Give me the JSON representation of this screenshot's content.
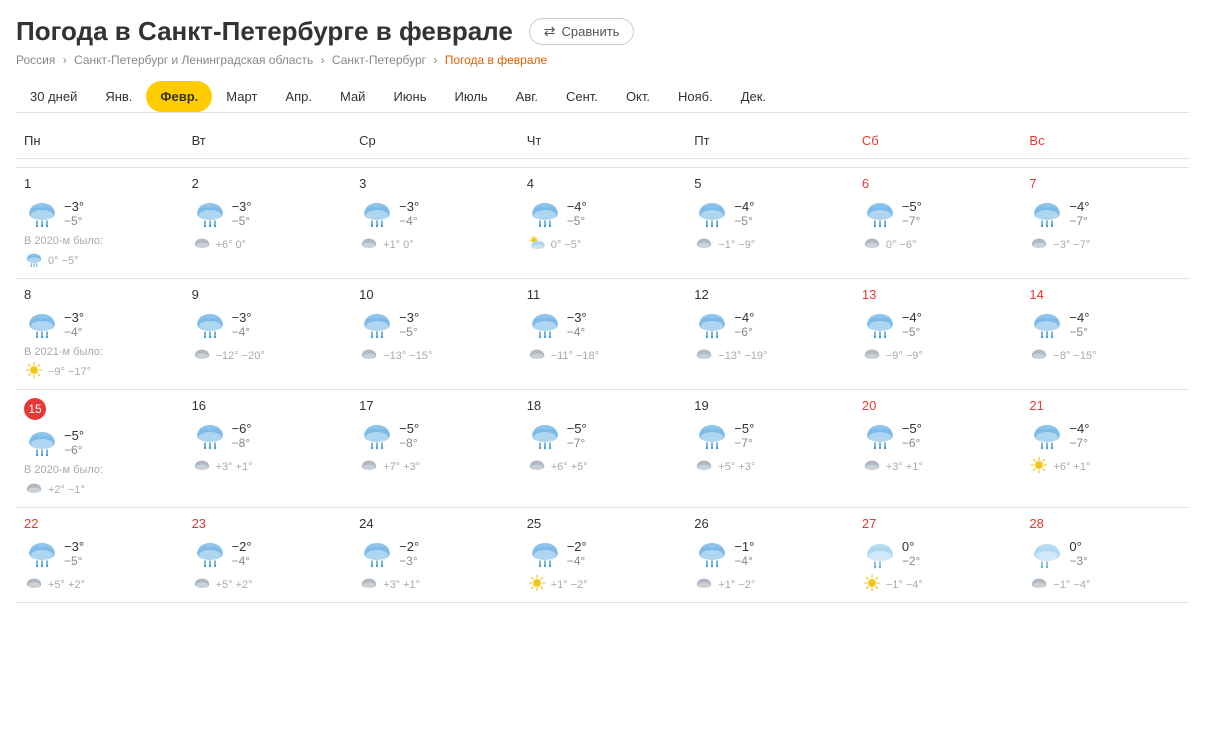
{
  "page": {
    "title": "Погода в Санкт-Петербурге в феврале",
    "compare_btn": "Сравнить"
  },
  "breadcrumb": {
    "items": [
      "Россия",
      "Санкт-Петербург и Ленинградская область",
      "Санкт-Петербург"
    ],
    "active": "Погода в феврале"
  },
  "tabs": [
    {
      "label": "30 дней",
      "active": false
    },
    {
      "label": "Янв.",
      "active": false
    },
    {
      "label": "Февр.",
      "active": true
    },
    {
      "label": "Март",
      "active": false
    },
    {
      "label": "Апр.",
      "active": false
    },
    {
      "label": "Май",
      "active": false
    },
    {
      "label": "Июнь",
      "active": false
    },
    {
      "label": "Июль",
      "active": false
    },
    {
      "label": "Авг.",
      "active": false
    },
    {
      "label": "Сент.",
      "active": false
    },
    {
      "label": "Окт.",
      "active": false
    },
    {
      "label": "Нояб.",
      "active": false
    },
    {
      "label": "Дек.",
      "active": false
    }
  ],
  "day_headers": [
    {
      "label": "Пн",
      "weekend": false
    },
    {
      "label": "Вт",
      "weekend": false
    },
    {
      "label": "Ср",
      "weekend": false
    },
    {
      "label": "Чт",
      "weekend": false
    },
    {
      "label": "Пт",
      "weekend": false
    },
    {
      "label": "Сб",
      "weekend": true
    },
    {
      "label": "Вс",
      "weekend": true
    }
  ],
  "weeks": [
    {
      "days": [
        {
          "num": 1,
          "weekend": false,
          "icon": "snow-cloud",
          "high": "−3°",
          "low": "−5°",
          "has_prev": true,
          "prev_label": "В 2020-м было:",
          "prev_icon": "snow-cloud",
          "prev_temps": "0° −5°"
        },
        {
          "num": 2,
          "weekend": false,
          "icon": "snow-cloud",
          "high": "−3°",
          "low": "−5°",
          "has_prev": false,
          "prev_temps": "+6° 0°",
          "prev_icon": "cloud-grey"
        },
        {
          "num": 3,
          "weekend": false,
          "icon": "snow-cloud",
          "high": "−3°",
          "low": "−4°",
          "has_prev": false,
          "prev_temps": "+1° 0°",
          "prev_icon": "cloud-grey"
        },
        {
          "num": 4,
          "weekend": false,
          "icon": "snow-cloud",
          "high": "−4°",
          "low": "−5°",
          "has_prev": false,
          "prev_temps": "0° −5°",
          "prev_icon": "sun-cloud"
        },
        {
          "num": 5,
          "weekend": false,
          "icon": "snow-cloud",
          "high": "−4°",
          "low": "−5°",
          "has_prev": false,
          "prev_temps": "−1° −9°",
          "prev_icon": "cloud-grey"
        },
        {
          "num": 6,
          "weekend": true,
          "icon": "snow-cloud",
          "high": "−5°",
          "low": "−7°",
          "has_prev": false,
          "prev_temps": "0° −6°",
          "prev_icon": "cloud-grey"
        },
        {
          "num": 7,
          "weekend": true,
          "icon": "snow-cloud",
          "high": "−4°",
          "low": "−7°",
          "has_prev": false,
          "prev_temps": "−3° −7°",
          "prev_icon": "cloud-grey"
        }
      ]
    },
    {
      "days": [
        {
          "num": 8,
          "weekend": false,
          "icon": "snow-cloud",
          "high": "−3°",
          "low": "−4°",
          "has_prev": true,
          "prev_label": "В 2021-м было:",
          "prev_icon": "sun",
          "prev_temps": "−9° −17°"
        },
        {
          "num": 9,
          "weekend": false,
          "icon": "snow-cloud",
          "high": "−3°",
          "low": "−4°",
          "has_prev": false,
          "prev_temps": "−12° −20°",
          "prev_icon": "cloud-grey"
        },
        {
          "num": 10,
          "weekend": false,
          "icon": "snow-cloud",
          "high": "−3°",
          "low": "−5°",
          "has_prev": false,
          "prev_temps": "−13° −15°",
          "prev_icon": "cloud-grey"
        },
        {
          "num": 11,
          "weekend": false,
          "icon": "snow-cloud",
          "high": "−3°",
          "low": "−4°",
          "has_prev": false,
          "prev_temps": "−11° −18°",
          "prev_icon": "cloud-grey"
        },
        {
          "num": 12,
          "weekend": false,
          "icon": "snow-cloud",
          "high": "−4°",
          "low": "−6°",
          "has_prev": false,
          "prev_temps": "−13° −19°",
          "prev_icon": "cloud-grey"
        },
        {
          "num": 13,
          "weekend": true,
          "icon": "snow-cloud",
          "high": "−4°",
          "low": "−5°",
          "has_prev": false,
          "prev_temps": "−9° −9°",
          "prev_icon": "cloud-grey"
        },
        {
          "num": 14,
          "weekend": true,
          "icon": "snow-cloud",
          "high": "−4°",
          "low": "−5°",
          "has_prev": false,
          "prev_temps": "−8° −15°",
          "prev_icon": "cloud-grey"
        }
      ]
    },
    {
      "days": [
        {
          "num": 15,
          "weekend": false,
          "today": true,
          "icon": "snow-cloud",
          "high": "−5°",
          "low": "−6°",
          "has_prev": true,
          "prev_label": "В 2020-м было:",
          "prev_icon": "cloud-grey",
          "prev_temps": "+2° −1°"
        },
        {
          "num": 16,
          "weekend": false,
          "icon": "snow-cloud",
          "high": "−6°",
          "low": "−8°",
          "has_prev": false,
          "prev_temps": "+3° +1°",
          "prev_icon": "cloud-grey"
        },
        {
          "num": 17,
          "weekend": false,
          "icon": "snow-cloud",
          "high": "−5°",
          "low": "−8°",
          "has_prev": false,
          "prev_temps": "+7° +3°",
          "prev_icon": "cloud-grey"
        },
        {
          "num": 18,
          "weekend": false,
          "icon": "snow-cloud",
          "high": "−5°",
          "low": "−7°",
          "has_prev": false,
          "prev_temps": "+6° +5°",
          "prev_icon": "cloud-grey"
        },
        {
          "num": 19,
          "weekend": false,
          "icon": "snow-cloud",
          "high": "−5°",
          "low": "−7°",
          "has_prev": false,
          "prev_temps": "+5° +3°",
          "prev_icon": "cloud-grey"
        },
        {
          "num": 20,
          "weekend": true,
          "icon": "snow-cloud",
          "high": "−5°",
          "low": "−6°",
          "has_prev": false,
          "prev_temps": "+3° +1°",
          "prev_icon": "cloud-grey"
        },
        {
          "num": 21,
          "weekend": true,
          "icon": "snow-cloud",
          "high": "−4°",
          "low": "−7°",
          "has_prev": false,
          "prev_temps": "+6° +1°",
          "prev_icon": "sun"
        }
      ]
    },
    {
      "days": [
        {
          "num": 22,
          "weekend": true,
          "icon": "snow-cloud",
          "high": "−3°",
          "low": "−5°",
          "has_prev": false,
          "prev_temps": "+5° +2°",
          "prev_icon": "cloud-grey"
        },
        {
          "num": 23,
          "weekend": true,
          "icon": "snow-cloud",
          "high": "−2°",
          "low": "−4°",
          "has_prev": false,
          "prev_temps": "+5° +2°",
          "prev_icon": "cloud-grey"
        },
        {
          "num": 24,
          "weekend": false,
          "icon": "snow-cloud",
          "high": "−2°",
          "low": "−3°",
          "has_prev": false,
          "prev_temps": "+3° +1°",
          "prev_icon": "cloud-grey"
        },
        {
          "num": 25,
          "weekend": false,
          "icon": "snow-cloud",
          "high": "−2°",
          "low": "−4°",
          "has_prev": false,
          "prev_temps": "+1° −2°",
          "prev_icon": "sun"
        },
        {
          "num": 26,
          "weekend": false,
          "icon": "snow-cloud",
          "high": "−1°",
          "low": "−4°",
          "has_prev": false,
          "prev_temps": "+1° −2°",
          "prev_icon": "cloud-grey"
        },
        {
          "num": 27,
          "weekend": true,
          "icon": "snow-cloud-light",
          "high": "0°",
          "low": "−2°",
          "has_prev": false,
          "prev_temps": "−1° −4°",
          "prev_icon": "sun"
        },
        {
          "num": 28,
          "weekend": true,
          "icon": "snow-cloud-light",
          "high": "0°",
          "low": "−3°",
          "has_prev": false,
          "prev_temps": "−1° −4°",
          "prev_icon": "cloud-grey"
        }
      ]
    }
  ]
}
